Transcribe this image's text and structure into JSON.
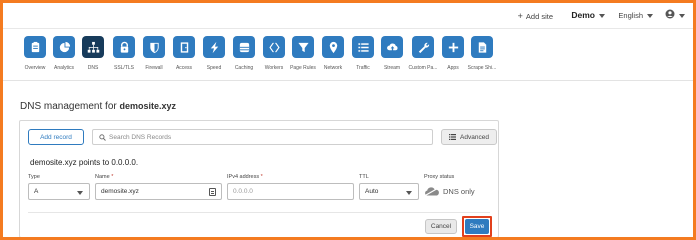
{
  "topbar": {
    "add_site": "Add site",
    "account": "Demo",
    "language": "English"
  },
  "apps": [
    {
      "label": "Overview",
      "icon": "overview-icon",
      "active": false
    },
    {
      "label": "Analytics",
      "icon": "analytics-icon",
      "active": false
    },
    {
      "label": "DNS",
      "icon": "dns-icon",
      "active": true
    },
    {
      "label": "SSL/TLS",
      "icon": "lock-icon",
      "active": false
    },
    {
      "label": "Firewall",
      "icon": "shield-icon",
      "active": false
    },
    {
      "label": "Access",
      "icon": "door-icon",
      "active": false
    },
    {
      "label": "Speed",
      "icon": "lightning-icon",
      "active": false
    },
    {
      "label": "Caching",
      "icon": "server-icon",
      "active": false
    },
    {
      "label": "Workers",
      "icon": "workers-icon",
      "active": false
    },
    {
      "label": "Page Rules",
      "icon": "funnel-icon",
      "active": false
    },
    {
      "label": "Network",
      "icon": "location-pin-icon",
      "active": false
    },
    {
      "label": "Traffic",
      "icon": "list-icon",
      "active": false
    },
    {
      "label": "Stream",
      "icon": "cloud-upload-icon",
      "active": false
    },
    {
      "label": "Custom Pa...",
      "icon": "wrench-icon",
      "active": false
    },
    {
      "label": "Apps",
      "icon": "plus-icon",
      "active": false
    },
    {
      "label": "Scrape Shi...",
      "icon": "document-icon",
      "active": false
    }
  ],
  "page": {
    "title_prefix": "DNS management for",
    "domain": "demosite.xyz"
  },
  "dns": {
    "add_record_label": "Add record",
    "search_placeholder": "Search DNS Records",
    "advanced_label": "Advanced",
    "points_to_text": "demosite.xyz points to 0.0.0.0.",
    "type_label": "Type",
    "type_value": "A",
    "name_label": "Name",
    "name_value": "demosite.xyz",
    "ipv4_label": "IPv4 address",
    "ipv4_placeholder": "0.0.0.0",
    "ttl_label": "TTL",
    "ttl_value": "Auto",
    "proxy_label": "Proxy status",
    "proxy_value": "DNS only",
    "required_marker": "*",
    "cancel_label": "Cancel",
    "save_label": "Save"
  },
  "colors": {
    "accent": "#2f7bbf",
    "active_tile": "#173b5b",
    "frame_border": "#f47b20",
    "highlight": "#e2401c"
  }
}
